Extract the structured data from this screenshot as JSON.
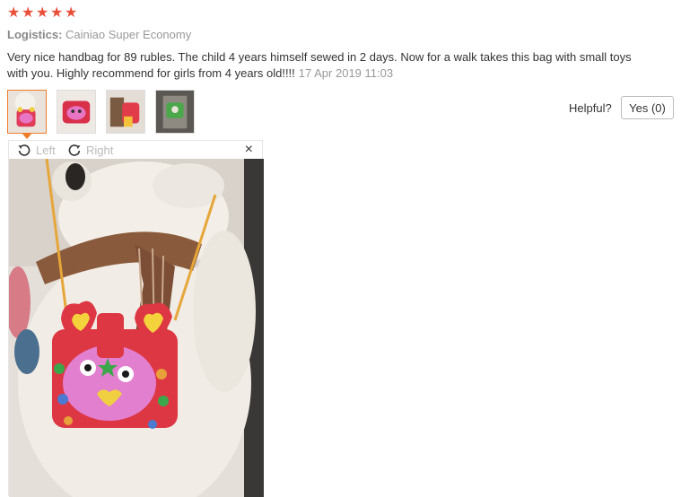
{
  "rating": {
    "stars": [
      "★",
      "★",
      "★",
      "★",
      "★"
    ],
    "color": "#e8503a"
  },
  "logistics": {
    "label": "Logistics:",
    "value": "Cainiao Super Economy"
  },
  "review": {
    "text": "Very nice handbag for 89 rubles. The child 4 years himself sewed in 2 days. Now for a walk takes this bag with small toys with you. Highly recommend for girls from 4 years old!!!!",
    "date": "17 Apr 2019 11:03"
  },
  "helpful": {
    "label": "Helpful?",
    "button_label": "Yes (0)"
  },
  "viewer": {
    "rotate_left_label": "Left",
    "rotate_right_label": "Right",
    "close_symbol": "×"
  },
  "icons": {
    "star": "star-icon",
    "rotate_left": "rotate-left-icon",
    "rotate_right": "rotate-right-icon",
    "close": "close-icon"
  },
  "colors": {
    "accent": "#f07c2a",
    "star": "#e8503a",
    "muted": "#999999"
  }
}
